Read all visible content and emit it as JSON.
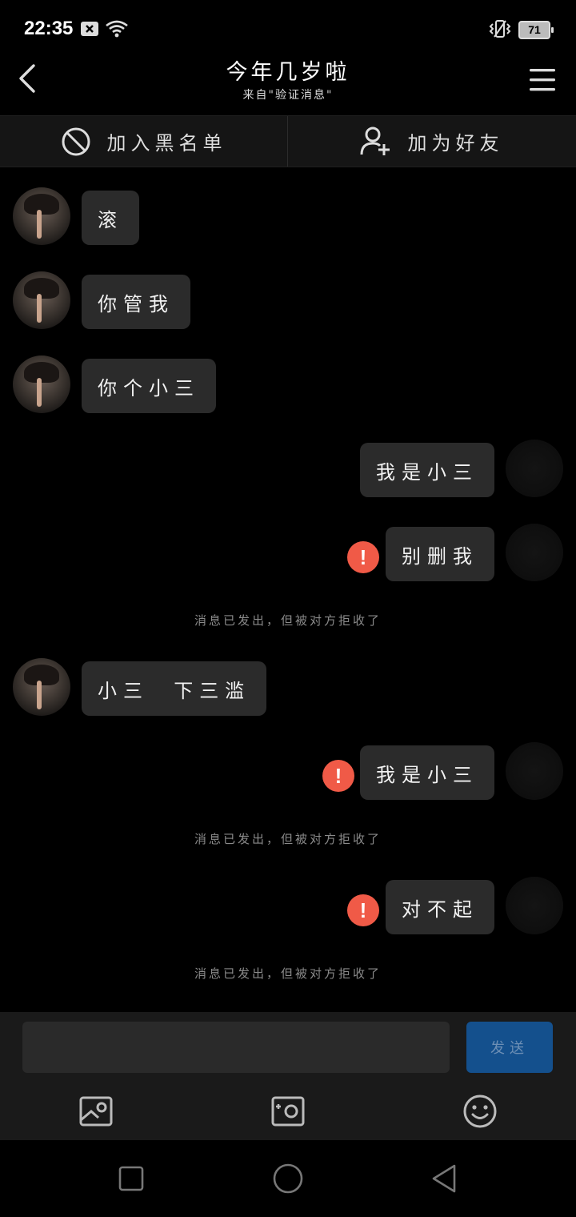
{
  "status_bar": {
    "time": "22:35",
    "battery": "71",
    "icons": [
      "notification-x-icon",
      "wifi-icon",
      "vibrate-icon",
      "battery-icon"
    ]
  },
  "header": {
    "title": "今年几岁啦",
    "subtitle": "来自\"验证消息\""
  },
  "actions": {
    "blacklist_label": "加入黑名单",
    "add_friend_label": "加为好友"
  },
  "messages": [
    {
      "side": "left",
      "text": "滚"
    },
    {
      "side": "left",
      "text": "你管我"
    },
    {
      "side": "left",
      "text": "你个小三"
    },
    {
      "side": "right",
      "text": "我是小三",
      "failed": false
    },
    {
      "side": "right",
      "text": "别删我",
      "failed": true
    },
    {
      "side": "system",
      "text": "消息已发出，但被对方拒收了"
    },
    {
      "side": "left",
      "text": "小三  下三滥"
    },
    {
      "side": "right",
      "text": "我是小三",
      "failed": true
    },
    {
      "side": "system",
      "text": "消息已发出，但被对方拒收了"
    },
    {
      "side": "right",
      "text": "对不起",
      "failed": true
    },
    {
      "side": "system",
      "text": "消息已发出，但被对方拒收了"
    }
  ],
  "composer": {
    "value": "",
    "send_label": "发送"
  },
  "colors": {
    "background": "#000000",
    "bubble": "#2b2b2b",
    "error": "#f05a47",
    "send_button": "#14508d"
  }
}
